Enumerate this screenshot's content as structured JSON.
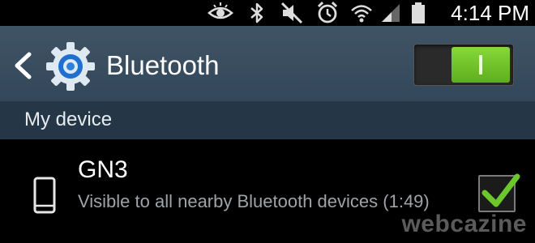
{
  "status_bar": {
    "time": "4:14 PM",
    "icons": [
      "eye-icon",
      "bluetooth-icon",
      "mute-icon",
      "alarm-icon",
      "wifi-icon",
      "signal-icon",
      "battery-icon"
    ]
  },
  "action_bar": {
    "back_icon": "chevron-left-icon",
    "app_icon": "gear-icon",
    "title": "Bluetooth",
    "toggle_on": true,
    "accent": "#6cc72a"
  },
  "section": {
    "label": "My device"
  },
  "device": {
    "icon": "phone-icon",
    "name": "GN3",
    "subtitle": "Visible to all nearby Bluetooth devices (1:49)",
    "visible_checked": true
  },
  "watermark": "webcazine",
  "colors": {
    "action_bar": "#3b4f61",
    "section_header": "#253646",
    "background": "#000000",
    "check": "#6cc72a"
  }
}
